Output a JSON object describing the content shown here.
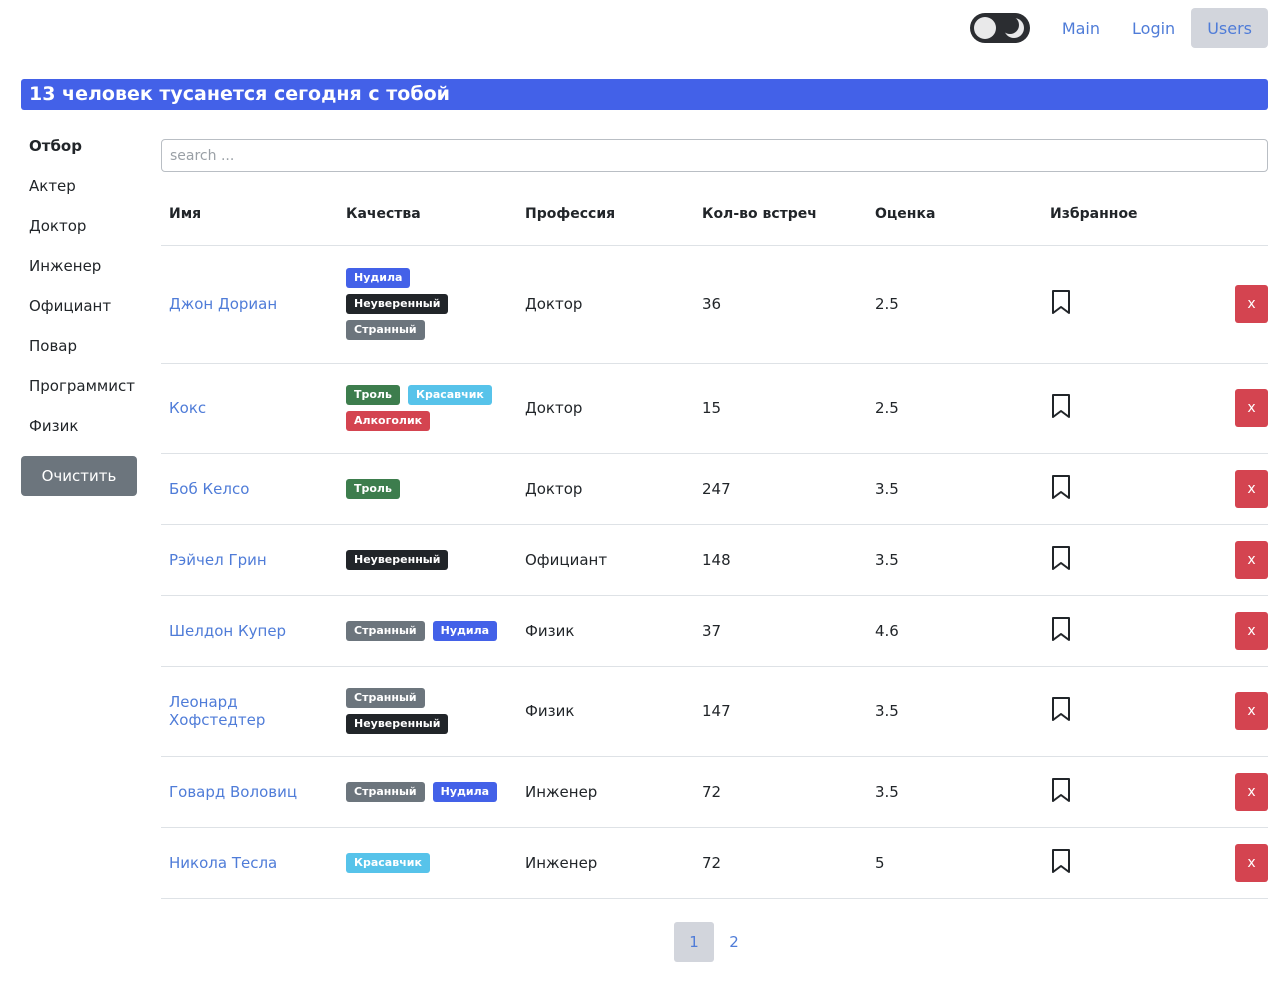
{
  "nav": {
    "links": [
      {
        "label": "Main",
        "active": false
      },
      {
        "label": "Login",
        "active": false
      },
      {
        "label": "Users",
        "active": true
      }
    ]
  },
  "banner": {
    "text": "13 человек тусанется сегодня с тобой",
    "color": "#4361e8"
  },
  "sidebar": {
    "header": "Отбор",
    "items": [
      "Актер",
      "Доктор",
      "Инженер",
      "Официант",
      "Повар",
      "Программист",
      "Физик"
    ],
    "clear_label": "Очистить"
  },
  "search": {
    "placeholder": "search ..."
  },
  "table": {
    "headers": [
      "Имя",
      "Качества",
      "Профессия",
      "Кол-во встреч",
      "Оценка",
      "Избранное"
    ],
    "rows": [
      {
        "name": "Джон Дориан",
        "qualities": [
          {
            "label": "Нудила",
            "color": "#4361e8"
          },
          {
            "label": "Неуверенный",
            "color": "#212529"
          },
          {
            "label": "Странный",
            "color": "#6c757d"
          }
        ],
        "profession": "Доктор",
        "meetings": "36",
        "rate": "2.5",
        "delete": "x"
      },
      {
        "name": "Кокс",
        "qualities": [
          {
            "label": "Троль",
            "color": "#3d7d4d"
          },
          {
            "label": "Красавчик",
            "color": "#57c3ea"
          },
          {
            "label": "Алкоголик",
            "color": "#d44450"
          }
        ],
        "profession": "Доктор",
        "meetings": "15",
        "rate": "2.5",
        "delete": "x"
      },
      {
        "name": "Боб Келсо",
        "qualities": [
          {
            "label": "Троль",
            "color": "#3d7d4d"
          }
        ],
        "profession": "Доктор",
        "meetings": "247",
        "rate": "3.5",
        "delete": "x"
      },
      {
        "name": "Рэйчел Грин",
        "qualities": [
          {
            "label": "Неуверенный",
            "color": "#212529"
          }
        ],
        "profession": "Официант",
        "meetings": "148",
        "rate": "3.5",
        "delete": "x"
      },
      {
        "name": "Шелдон Купер",
        "qualities": [
          {
            "label": "Странный",
            "color": "#6c757d"
          },
          {
            "label": "Нудила",
            "color": "#4361e8"
          }
        ],
        "profession": "Физик",
        "meetings": "37",
        "rate": "4.6",
        "delete": "x"
      },
      {
        "name": "Леонард Хофстедтер",
        "qualities": [
          {
            "label": "Странный",
            "color": "#6c757d"
          },
          {
            "label": "Неуверенный",
            "color": "#212529"
          }
        ],
        "profession": "Физик",
        "meetings": "147",
        "rate": "3.5",
        "delete": "x"
      },
      {
        "name": "Говард Воловиц",
        "qualities": [
          {
            "label": "Странный",
            "color": "#6c757d"
          },
          {
            "label": "Нудила",
            "color": "#4361e8"
          }
        ],
        "profession": "Инженер",
        "meetings": "72",
        "rate": "3.5",
        "delete": "x"
      },
      {
        "name": "Никола Тесла",
        "qualities": [
          {
            "label": "Красавчик",
            "color": "#57c3ea"
          }
        ],
        "profession": "Инженер",
        "meetings": "72",
        "rate": "5",
        "delete": "x"
      }
    ]
  },
  "pagination": {
    "pages": [
      "1",
      "2"
    ],
    "current": "1"
  },
  "icons": {
    "bookmark": "bookmark-icon",
    "theme": "theme-toggle-icon"
  }
}
